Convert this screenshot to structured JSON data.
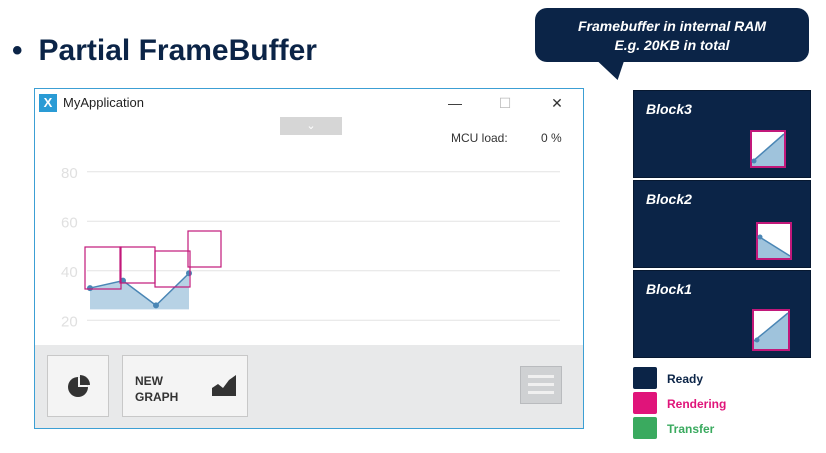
{
  "slide": {
    "bullet": "•",
    "title": "Partial FrameBuffer"
  },
  "callout": {
    "line1": "Framebuffer in internal RAM",
    "line2": "E.g. 20KB in total"
  },
  "window": {
    "title": "MyApplication",
    "minimize": "—",
    "maximize": "☐",
    "close": "✕",
    "chevron": "⌄",
    "mcu_label": "MCU load:",
    "mcu_value": "0 %",
    "new_graph_label": "NEW\nGRAPH"
  },
  "chart_data": {
    "type": "area",
    "title": "",
    "xlabel": "",
    "ylabel": "",
    "ylim": [
      10,
      90
    ],
    "yticks": [
      20,
      40,
      60,
      80
    ],
    "x": [
      0,
      1,
      2,
      3
    ],
    "values": [
      33,
      36,
      26,
      39
    ],
    "grid": true
  },
  "blocks": [
    {
      "label": "Block3"
    },
    {
      "label": "Block2"
    },
    {
      "label": "Block1"
    }
  ],
  "legend": [
    {
      "label": "Ready",
      "color": "#0b2447",
      "text_color": "#0b2447"
    },
    {
      "label": "Rendering",
      "color": "#e0147a",
      "text_color": "#e0147a"
    },
    {
      "label": "Transfer",
      "color": "#3aaa5f",
      "text_color": "#3aaa5f"
    }
  ],
  "colors": {
    "navy": "#0b2447",
    "magenta": "#c2187a",
    "area_fill": "#9fc3dc",
    "line": "#4a86b5"
  }
}
